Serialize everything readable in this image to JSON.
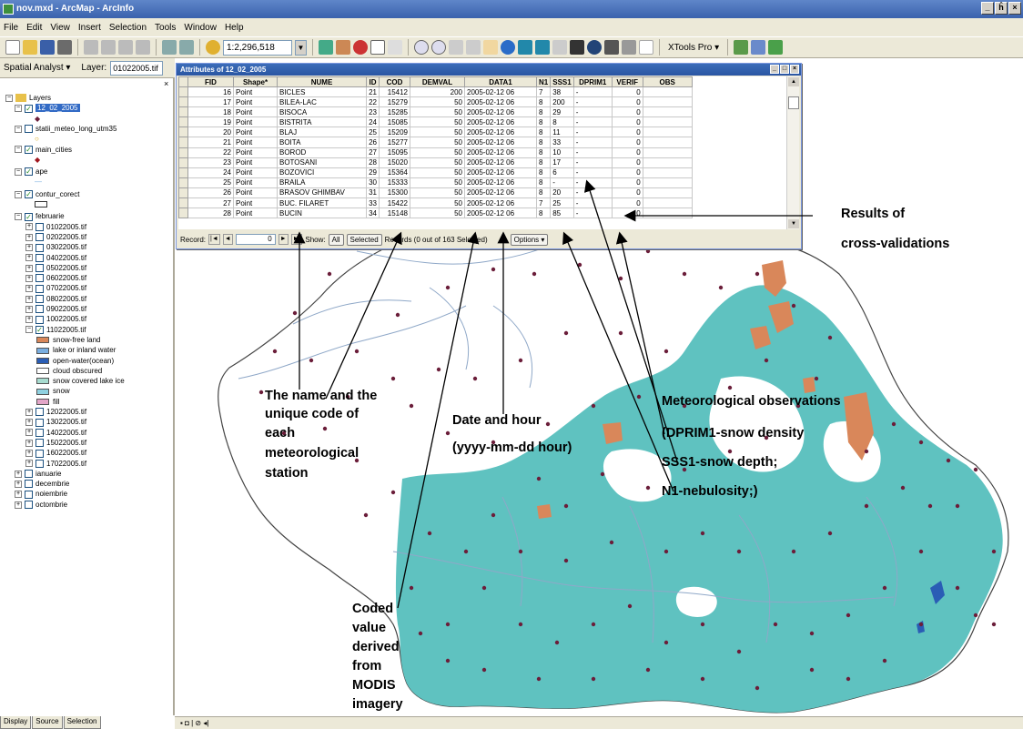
{
  "window": {
    "title": "nov.mxd - ArcMap - ArcInfo",
    "minimize": "_",
    "restore": "ĥ",
    "close": "×"
  },
  "menu": [
    "File",
    "Edit",
    "View",
    "Insert",
    "Selection",
    "Tools",
    "Window",
    "Help"
  ],
  "toolbar": {
    "scale": "1:2,296,518",
    "xtools": "XTools Pro ▾"
  },
  "toolbar2": {
    "spatial_analyst": "Spatial Analyst ▾",
    "layer_label": "Layer:",
    "layer_value": "01022005.tif"
  },
  "toc": {
    "close": "×",
    "root": "Layers",
    "layers": [
      {
        "label": "12_02_2005",
        "checked": true,
        "expanded": true,
        "selected": true
      },
      {
        "label": "statii_meteo_long_utm35",
        "checked": false,
        "expanded": true
      },
      {
        "label": "main_cities",
        "checked": true,
        "expanded": true
      },
      {
        "label": "ape",
        "checked": true,
        "expanded": true
      },
      {
        "label": "contur_corect",
        "checked": true,
        "expanded": true
      },
      {
        "label": "februarie",
        "checked": true,
        "expanded": true
      }
    ],
    "rasters_before": [
      "01022005.tif",
      "02022005.tif",
      "03022005.tif",
      "04022005.tif",
      "05022005.tif",
      "06022005.tif",
      "07022005.tif",
      "08022005.tif",
      "09022005.tif",
      "10022005.tif"
    ],
    "active_raster": "11022005.tif",
    "legend": [
      {
        "label": "snow-free land",
        "color": "#d9875a"
      },
      {
        "label": "lake or inland water",
        "color": "#7aaee0"
      },
      {
        "label": "open-water(ocean)",
        "color": "#2a5db5"
      },
      {
        "label": "cloud obscured",
        "color": "#ffffff"
      },
      {
        "label": "snow covered lake ice",
        "color": "#a8dcd0"
      },
      {
        "label": "snow",
        "color": "#8fd1e0"
      },
      {
        "label": "fill",
        "color": "#e3a6c8"
      }
    ],
    "rasters_after": [
      "12022005.tif",
      "13022005.tif",
      "14022005.tif",
      "15022005.tif",
      "16022005.tif",
      "17022005.tif"
    ],
    "groups": [
      "ianuarie",
      "decembrie",
      "noiembrie",
      "octombrie"
    ],
    "tabs": [
      "Display",
      "Source",
      "Selection"
    ]
  },
  "attr_window": {
    "title": "Attributes of 12_02_2005",
    "columns": [
      "FID",
      "Shape*",
      "NUME",
      "ID",
      "COD",
      "DEMVAL",
      "DATA1",
      "N1",
      "SSS1",
      "DPRIM1",
      "VERIF",
      "OBS"
    ],
    "rows": [
      [
        "16",
        "Point",
        "BICLES",
        "21",
        "15412",
        "200",
        "2005-02-12 06",
        "7",
        "38",
        "-",
        "0",
        ""
      ],
      [
        "17",
        "Point",
        "BILEA-LAC",
        "22",
        "15279",
        "50",
        "2005-02-12 06",
        "8",
        "200",
        "-",
        "0",
        ""
      ],
      [
        "18",
        "Point",
        "BISOCA",
        "23",
        "15285",
        "50",
        "2005-02-12 06",
        "8",
        "29",
        "-",
        "0",
        ""
      ],
      [
        "19",
        "Point",
        "BISTRITA",
        "24",
        "15085",
        "50",
        "2005-02-12 06",
        "8",
        "8",
        "-",
        "0",
        ""
      ],
      [
        "20",
        "Point",
        "BLAJ",
        "25",
        "15209",
        "50",
        "2005-02-12 06",
        "8",
        "11",
        "-",
        "0",
        ""
      ],
      [
        "21",
        "Point",
        "BOITA",
        "26",
        "15277",
        "50",
        "2005-02-12 06",
        "8",
        "33",
        "-",
        "0",
        ""
      ],
      [
        "22",
        "Point",
        "BOROD",
        "27",
        "15095",
        "50",
        "2005-02-12 06",
        "8",
        "10",
        "-",
        "0",
        ""
      ],
      [
        "23",
        "Point",
        "BOTOSANI",
        "28",
        "15020",
        "50",
        "2005-02-12 06",
        "8",
        "17",
        "-",
        "0",
        ""
      ],
      [
        "24",
        "Point",
        "BOZOVICI",
        "29",
        "15364",
        "50",
        "2005-02-12 06",
        "8",
        "6",
        "-",
        "0",
        ""
      ],
      [
        "25",
        "Point",
        "BRAILA",
        "30",
        "15333",
        "50",
        "2005-02-12 06",
        "8",
        "-",
        "-",
        "0",
        ""
      ],
      [
        "26",
        "Point",
        "BRASOV GHIMBAV",
        "31",
        "15300",
        "50",
        "2005-02-12 06",
        "8",
        "20",
        "-",
        "0",
        ""
      ],
      [
        "27",
        "Point",
        "BUC. FILARET",
        "33",
        "15422",
        "50",
        "2005-02-12 06",
        "7",
        "25",
        "-",
        "0",
        ""
      ],
      [
        "28",
        "Point",
        "BUCIN",
        "34",
        "15148",
        "50",
        "2005-02-12 06",
        "8",
        "85",
        "-",
        "0",
        ""
      ]
    ],
    "nav": {
      "record_label": "Record:",
      "first": "|◄",
      "prev": "◄",
      "current": "0",
      "next": "►",
      "last": "►|",
      "show_label": "Show:",
      "all": "All",
      "selected": "Selected",
      "records": "Records (0 out of 163 Selected)",
      "options": "Options ▾"
    }
  },
  "annotations": {
    "results_1": "Results of",
    "results_2": "cross-validations",
    "name_1": "The name and the",
    "name_2": "unique code of",
    "name_3": "each",
    "name_4": "meteorological",
    "name_5": "station",
    "date_1": "Date and hour",
    "date_2": "(yyyy-mm-dd hour)",
    "met_1": "Meteorological observations",
    "met_2": "(DPRIM1-snow density",
    "met_3": "SSS1-snow depth;",
    "met_4": "N1-nebulosity;)",
    "coded_1": "Coded",
    "coded_2": "value",
    "coded_3": "derived",
    "coded_4": "from",
    "coded_5": "MODIS",
    "coded_6": "imagery"
  },
  "colors": {
    "snow": "#5fc2c0",
    "snow_free": "#d9875a",
    "station": "#6b1e3a",
    "river": "#8fa8c8"
  }
}
